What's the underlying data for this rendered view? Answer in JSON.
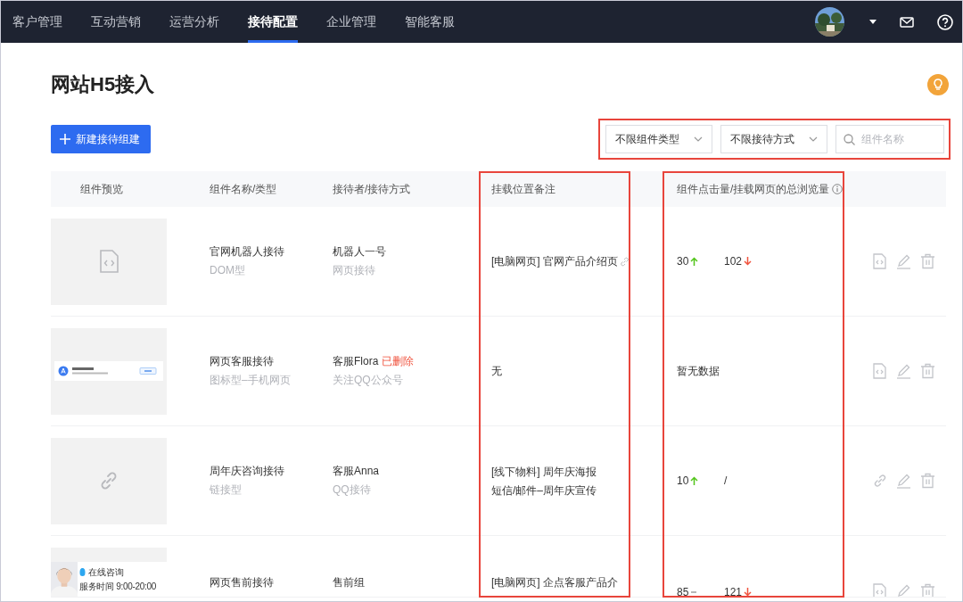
{
  "nav": {
    "items": [
      {
        "label": "客户管理",
        "selected": false
      },
      {
        "label": "互动营销",
        "selected": false
      },
      {
        "label": "运营分析",
        "selected": false
      },
      {
        "label": "接待配置",
        "selected": true
      },
      {
        "label": "企业管理",
        "selected": false
      },
      {
        "label": "智能客服",
        "selected": false
      }
    ]
  },
  "page": {
    "title": "网站H5接入",
    "new_button": "新建接待组建"
  },
  "filters": {
    "highlighted": true,
    "selects": [
      "不限组件类型",
      "不限接待方式"
    ],
    "search": {
      "placeholder": "组件名称"
    }
  },
  "table": {
    "columns": [
      {
        "kind": "preview",
        "label": "组件预览",
        "highlighted": false
      },
      {
        "kind": "name",
        "label": "组件名称/类型",
        "highlighted": false
      },
      {
        "kind": "receiver",
        "label": "接待者/接待方式",
        "highlighted": false
      },
      {
        "kind": "note",
        "label": "挂载位置备注",
        "highlighted": true
      },
      {
        "kind": "stats",
        "label": "组件点击量/挂载网页的总浏览量",
        "highlighted": true
      }
    ],
    "rows": [
      {
        "preview": {
          "kind": "file-code"
        },
        "name": "官网机器人接待",
        "type": "DOM型",
        "receiver": "机器人一号",
        "mode": "网页接待",
        "note_lines": [
          [
            {
              "text": "[电脑网页] 官网产品介绍页"
            },
            {
              "kind": "link-icon"
            }
          ]
        ],
        "stats": {
          "clicks": {
            "value": "30",
            "kind": "up"
          },
          "views": {
            "value": "102",
            "kind": "down"
          }
        },
        "actions": [
          {
            "kind": "code"
          },
          {
            "kind": "edit"
          },
          {
            "kind": "delete"
          }
        ]
      },
      {
        "preview": {
          "kind": "follow-card"
        },
        "name": "网页客服接待",
        "type": "图标型–手机网页",
        "receiver": "客服Flora",
        "receiver_tag": "已删除",
        "mode": "关注QQ公众号",
        "note_lines": [
          [
            {
              "text": "无"
            }
          ]
        ],
        "stats": {
          "empty_text": "暂无数据"
        },
        "actions": [
          {
            "kind": "code"
          },
          {
            "kind": "edit"
          },
          {
            "kind": "delete"
          }
        ]
      },
      {
        "preview": {
          "kind": "link"
        },
        "name": "周年庆咨询接待",
        "type": "链接型",
        "receiver": "客服Anna",
        "mode": "QQ接待",
        "note_lines": [
          [
            {
              "text": "[线下物料] 周年庆海报"
            }
          ],
          [
            {
              "text": "短信/邮件–周年庆宣传"
            }
          ]
        ],
        "stats": {
          "clicks": {
            "value": "10",
            "kind": "up"
          },
          "views": {
            "value": "/",
            "kind": "plain"
          }
        },
        "actions": [
          {
            "kind": "link"
          },
          {
            "kind": "edit"
          },
          {
            "kind": "delete"
          }
        ]
      },
      {
        "preview": {
          "kind": "consult-card",
          "title": "在线咨询",
          "subtitle": "服务时间 9:00-20:00"
        },
        "name": "网页售前接待",
        "receiver": "售前组",
        "note_lines": [
          [
            {
              "text": "[电脑网页] 企点客服产品介"
            }
          ]
        ],
        "stats": {
          "clicks": {
            "value": "85",
            "kind": "flat"
          },
          "views": {
            "value": "121",
            "kind": "down"
          }
        },
        "actions": [
          {
            "kind": "code"
          },
          {
            "kind": "edit"
          },
          {
            "kind": "delete"
          }
        ]
      }
    ]
  }
}
